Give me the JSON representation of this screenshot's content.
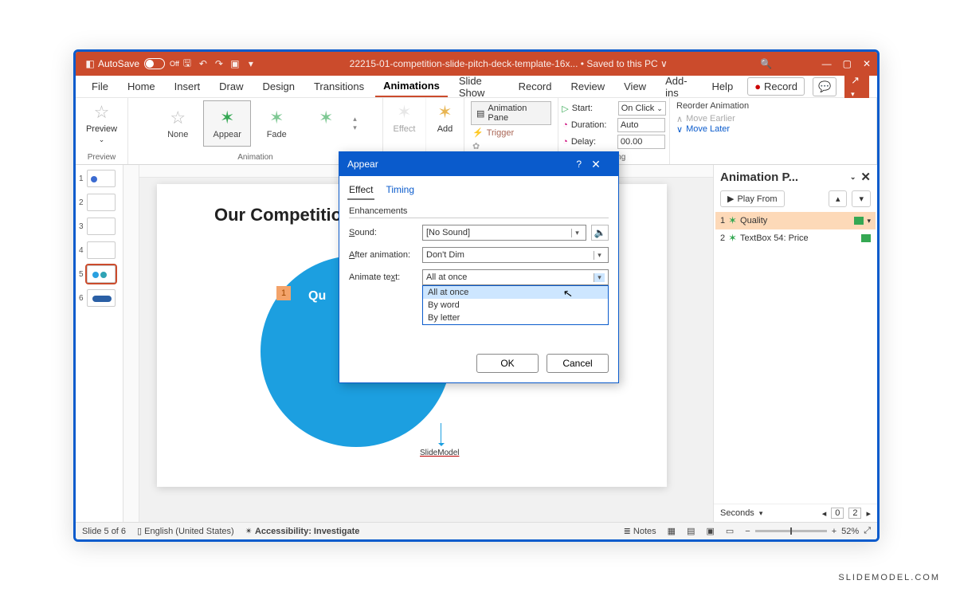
{
  "titlebar": {
    "autosave": "AutoSave",
    "autosave_state": "Off",
    "doc_title": "22215-01-competition-slide-pitch-deck-template-16x... • Saved to this PC ∨"
  },
  "menu": {
    "items": [
      "File",
      "Home",
      "Insert",
      "Draw",
      "Design",
      "Transitions",
      "Animations",
      "Slide Show",
      "Record",
      "Review",
      "View",
      "Add-ins",
      "Help"
    ],
    "active": "Animations",
    "record_btn": "Record",
    "share_glyph": "↗"
  },
  "ribbon": {
    "preview": "Preview",
    "preview_group": "Preview",
    "gallery": [
      "None",
      "Appear",
      "Fade"
    ],
    "gallery_selected": "Appear",
    "animation_group": "Animation",
    "effect": "Effect",
    "add": "Add",
    "anim_pane": "Animation Pane",
    "trigger": "Trigger",
    "start_lbl": "Start:",
    "start_val": "On Click",
    "duration_lbl": "Duration:",
    "duration_val": "Auto",
    "delay_lbl": "Delay:",
    "delay_val": "00.00",
    "timing_group": "Timing",
    "reorder": "Reorder Animation",
    "move_earlier": "Move Earlier",
    "move_later": "Move Later"
  },
  "thumbs": {
    "count": 6,
    "selected": 5
  },
  "slide": {
    "title": "Our Competition",
    "tag": "1",
    "quality": "Qu",
    "footer": "SlideModel"
  },
  "animpane": {
    "title": "Animation P...",
    "play": "Play From",
    "items": [
      {
        "n": "1",
        "label": "Quality",
        "sel": true
      },
      {
        "n": "2",
        "label": "TextBox 54: Price",
        "sel": false
      }
    ],
    "seconds": "Seconds",
    "range_a": "0",
    "range_b": "2"
  },
  "dialog": {
    "title": "Appear",
    "tabs": [
      "Effect",
      "Timing"
    ],
    "tab_active": "Effect",
    "section": "Enhancements",
    "sound_lbl_pre": "",
    "sound_lbl": "Sound:",
    "sound_u": "S",
    "sound_val": "[No Sound]",
    "after_lbl": "After animation:",
    "after_u": "A",
    "after_val": "Don't Dim",
    "animtext_lbl": "Animate text:",
    "animtext_u": "x",
    "animtext_val": "All at once",
    "options": [
      "All at once",
      "By word",
      "By letter"
    ],
    "ok": "OK",
    "cancel": "Cancel"
  },
  "status": {
    "slide": "Slide 5 of 6",
    "lang": "English (United States)",
    "access": "Accessibility: Investigate",
    "notes": "Notes",
    "zoom": "52%"
  },
  "watermark": "SLIDEMODEL.COM"
}
